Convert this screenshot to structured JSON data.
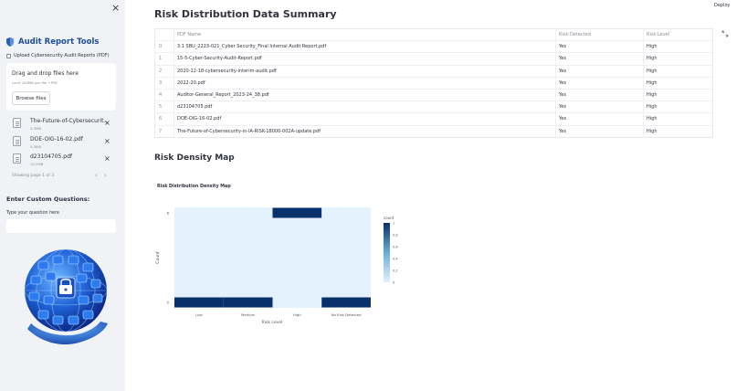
{
  "sidebar": {
    "close": "×",
    "title": "Audit Report Tools",
    "upload_label": "Upload Cybersecurity Audit Reports (PDF)",
    "dropzone": {
      "title": "Drag and drop files here",
      "limit": "Limit 200MB per file • PDF",
      "browse": "Browse files"
    },
    "files": [
      {
        "name": "The-Future-of-Cybersecurit...",
        "size": "2.3MB"
      },
      {
        "name": "DOE-OIG-16-02.pdf",
        "size": "0.3MB"
      },
      {
        "name": "d23104705.pdf",
        "size": "10.5MB"
      }
    ],
    "delete": "×",
    "paging": "Showing page 1 of 3",
    "prev": "‹",
    "next": "›",
    "custom_heading": "Enter Custom Questions:",
    "question_label": "Type your question here",
    "question_value": ""
  },
  "header": {
    "deploy": "Deploy"
  },
  "main": {
    "summary_heading": "Risk Distribution Data Summary",
    "density_heading": "Risk Density Map"
  },
  "table": {
    "columns": [
      "",
      "PDF Name",
      "Risk Detected",
      "Risk Level"
    ],
    "rows": [
      [
        "0",
        "3.1 SBU_2223-021_Cyber Security_Final Internal Audit Report.pdf",
        "Yes",
        "High"
      ],
      [
        "1",
        "15-5-Cyber-Security-Audit-Report.pdf",
        "Yes",
        "High"
      ],
      [
        "2",
        "2020-12-18-cybersecurity-interim-audit.pdf",
        "Yes",
        "High"
      ],
      [
        "3",
        "2022-20.pdf",
        "Yes",
        "High"
      ],
      [
        "4",
        "Auditor-General_Report_2023-24_38.pdf",
        "Yes",
        "High"
      ],
      [
        "5",
        "d23104705.pdf",
        "Yes",
        "High"
      ],
      [
        "6",
        "DOE-OIG-16-02.pdf",
        "Yes",
        "High"
      ],
      [
        "7",
        "The-Future-of-Cybersecurity-in-IA-RISK-18000-002A-update.pdf",
        "Yes",
        "High"
      ]
    ]
  },
  "chart_data": {
    "type": "heatmap",
    "title": "Risk Distribution Density Map",
    "xlabel": "Risk Level",
    "ylabel": "Count",
    "categories": [
      "Low",
      "Medium",
      "High",
      "No Risk Detected"
    ],
    "y": [
      0,
      8
    ],
    "z": [
      [
        1,
        1,
        0,
        1
      ],
      [
        0,
        0,
        1,
        0
      ]
    ],
    "colorbar": {
      "title": "count",
      "ticks": [
        "0",
        "0.2",
        "0.4",
        "0.6",
        "0.8",
        "1"
      ],
      "range": [
        0,
        1
      ]
    },
    "colors": {
      "low": "#e3f2fd",
      "high": "#08306b"
    }
  }
}
